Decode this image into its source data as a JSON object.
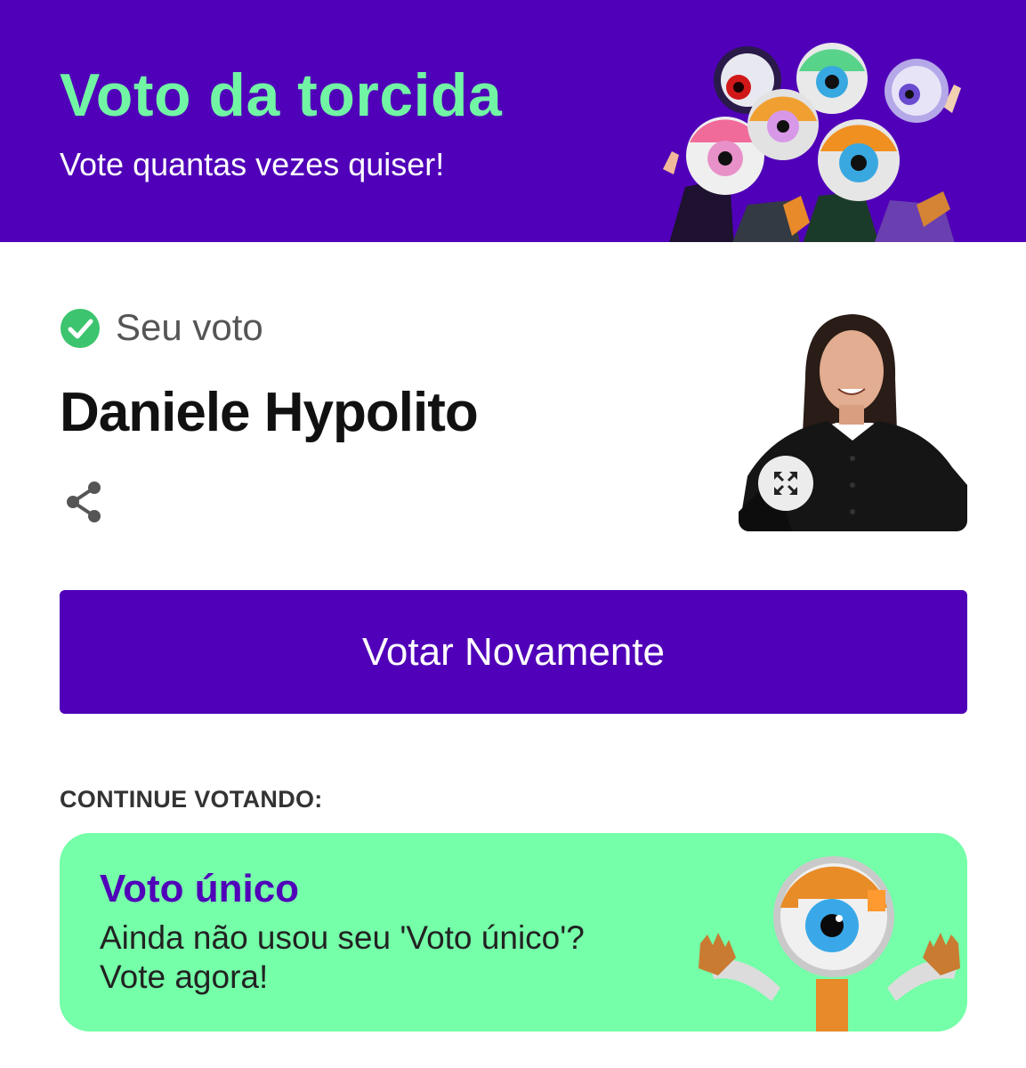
{
  "banner": {
    "title": "Voto da torcida",
    "subtitle": "Vote quantas vezes quiser!",
    "art_icon": "big-brother-eye-mascots-illustration"
  },
  "result": {
    "status_label": "Seu voto",
    "status_icon": "check-circle-icon",
    "candidate_name": "Daniele Hypolito",
    "share_icon": "share-icon",
    "expand_icon": "expand-icon"
  },
  "actions": {
    "vote_again_label": "Votar Novamente"
  },
  "continue_section": {
    "heading": "CONTINUE VOTANDO:",
    "card": {
      "title": "Voto único",
      "description_line1": "Ainda não usou seu 'Voto único'?",
      "description_line2": "Vote agora!",
      "art_icon": "eye-mascot-waving-illustration"
    }
  },
  "colors": {
    "brand_purple": "#5000b8",
    "accent_green": "#71f5a5",
    "card_green": "#74ffa8",
    "check_green": "#3cc46e"
  }
}
